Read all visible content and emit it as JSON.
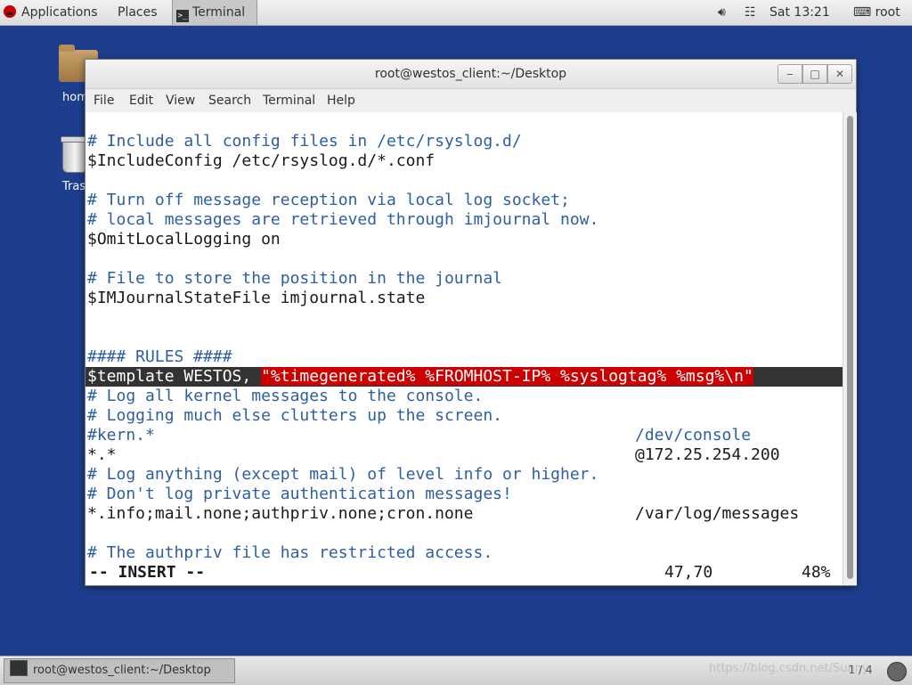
{
  "top_panel": {
    "applications": "Applications",
    "places": "Places",
    "terminal": "Terminal",
    "clock": "Sat 13:21",
    "user": "root"
  },
  "desktop": {
    "home_label": "hom",
    "trash_label": "Tras"
  },
  "window": {
    "title": "root@westos_client:~/Desktop",
    "menu": [
      "File",
      "Edit",
      "View",
      "Search",
      "Terminal",
      "Help"
    ]
  },
  "terminal_lines": {
    "l1": "# Include all config files in /etc/rsyslog.d/",
    "l2": "$IncludeConfig /etc/rsyslog.d/*.conf",
    "l3": "# Turn off message reception via local log socket;",
    "l4": "# local messages are retrieved through imjournal now.",
    "l5": "$OmitLocalLogging on",
    "l6": "# File to store the position in the journal",
    "l7": "$IMJournalStateFile imjournal.state",
    "l8": "#### RULES ####",
    "l9_prefix": "$template WESTOS, ",
    "l9_string": "\"%timegenerated% %FROMHOST-IP% %syslogtag% %msg%\\n\"",
    "l10": "# Log all kernel messages to the console.",
    "l11": "# Logging much else clutters up the screen.",
    "l12_left": "#kern.*",
    "l12_right": "/dev/console",
    "l13_left": "*.*",
    "l13_right": "@172.25.254.200",
    "l14": "# Log anything (except mail) of level info or higher.",
    "l15": "# Don't log private authentication messages!",
    "l16_left": "*.info;mail.none;authpriv.none;cron.none",
    "l16_right": "/var/log/messages",
    "l17": "# The authpriv file has restricted access."
  },
  "status": {
    "mode": "-- INSERT --",
    "position": "47,70",
    "percent": "48%"
  },
  "bottom_panel": {
    "task": "root@westos_client:~/Desktop",
    "watermark": "https://blog.csdn.net/Sunny",
    "workspace": "1 / 4"
  },
  "icons": {
    "volume": "volume-icon",
    "network": "network-icon",
    "user": "user-icon"
  }
}
